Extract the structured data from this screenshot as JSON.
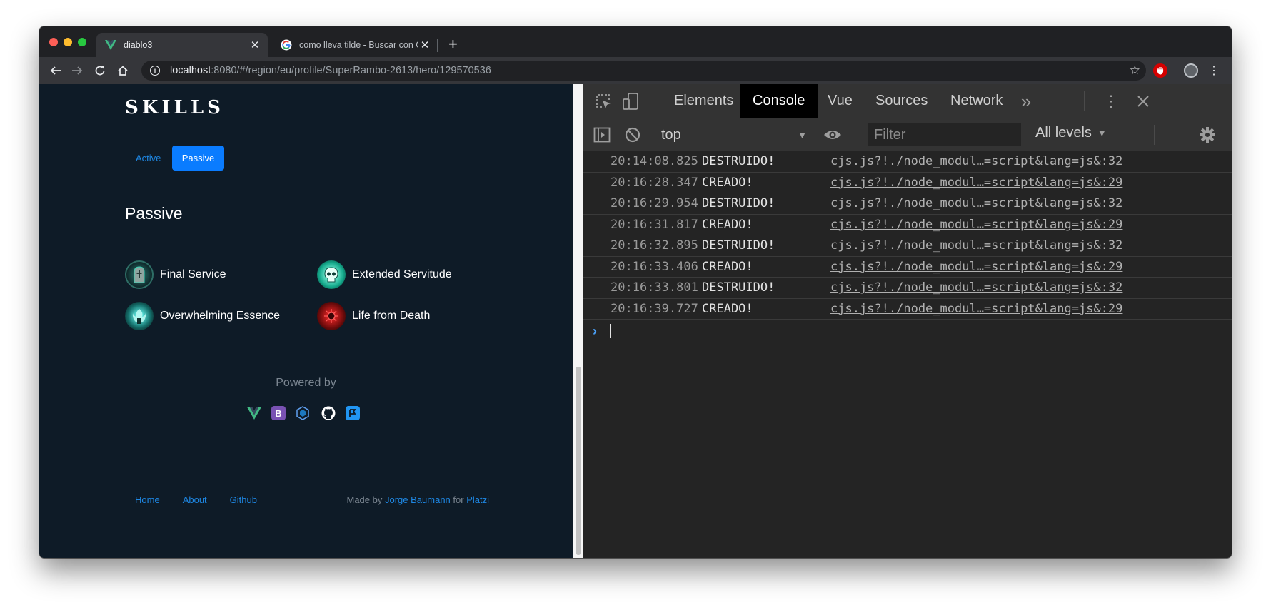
{
  "browser": {
    "tabs": [
      {
        "title": "diablo3",
        "favicon": "vue-logo-icon",
        "active": true
      },
      {
        "title": "como lleva tilde - Buscar con G",
        "favicon": "google-logo-icon",
        "active": false
      }
    ],
    "new_tab": "+",
    "url_host": "localhost",
    "url_rest": ":8080/#/region/eu/profile/SuperRambo-2613/hero/129570536"
  },
  "page": {
    "skills_title": "SKILLS",
    "tabs": {
      "active": "Active",
      "passive": "Passive"
    },
    "section_heading": "Passive",
    "skills": [
      {
        "name": "Final Service",
        "icon": "tombstone-icon"
      },
      {
        "name": "Extended Servitude",
        "icon": "skull-icon"
      },
      {
        "name": "Overwhelming Essence",
        "icon": "essence-icon"
      },
      {
        "name": "Life from Death",
        "icon": "blood-orb-icon"
      }
    ],
    "powered_by": "Powered by",
    "powered_icons": [
      "vue-icon",
      "bootstrap-icon",
      "webpack-icon",
      "github-icon",
      "platzi-icon"
    ],
    "footer": {
      "links": [
        "Home",
        "About",
        "Github"
      ],
      "made_by_prefix": "Made by",
      "author": "Jorge Baumann",
      "for_text": "for",
      "org": "Platzi"
    }
  },
  "devtools": {
    "tabs": [
      "Elements",
      "Console",
      "Vue",
      "Sources",
      "Network"
    ],
    "active_tab": "Console",
    "more_tabs": "»",
    "context": "top",
    "filter_placeholder": "Filter",
    "levels": "All levels",
    "logs": [
      {
        "time": "20:14:08.825",
        "msg": "DESTRUIDO!",
        "src": "cjs.js?!./node_modul…=script&lang=js&:32"
      },
      {
        "time": "20:16:28.347",
        "msg": "CREADO!",
        "src": "cjs.js?!./node_modul…=script&lang=js&:29"
      },
      {
        "time": "20:16:29.954",
        "msg": "DESTRUIDO!",
        "src": "cjs.js?!./node_modul…=script&lang=js&:32"
      },
      {
        "time": "20:16:31.817",
        "msg": "CREADO!",
        "src": "cjs.js?!./node_modul…=script&lang=js&:29"
      },
      {
        "time": "20:16:32.895",
        "msg": "DESTRUIDO!",
        "src": "cjs.js?!./node_modul…=script&lang=js&:32"
      },
      {
        "time": "20:16:33.406",
        "msg": "CREADO!",
        "src": "cjs.js?!./node_modul…=script&lang=js&:29"
      },
      {
        "time": "20:16:33.801",
        "msg": "DESTRUIDO!",
        "src": "cjs.js?!./node_modul…=script&lang=js&:32"
      },
      {
        "time": "20:16:39.727",
        "msg": "CREADO!",
        "src": "cjs.js?!./node_modul…=script&lang=js&:29"
      }
    ],
    "prompt": "›"
  },
  "colors": {
    "page_bg": "#0e1b27",
    "accent": "#0a7cff",
    "link": "#1e88e5",
    "devtools_bg": "#242424"
  }
}
